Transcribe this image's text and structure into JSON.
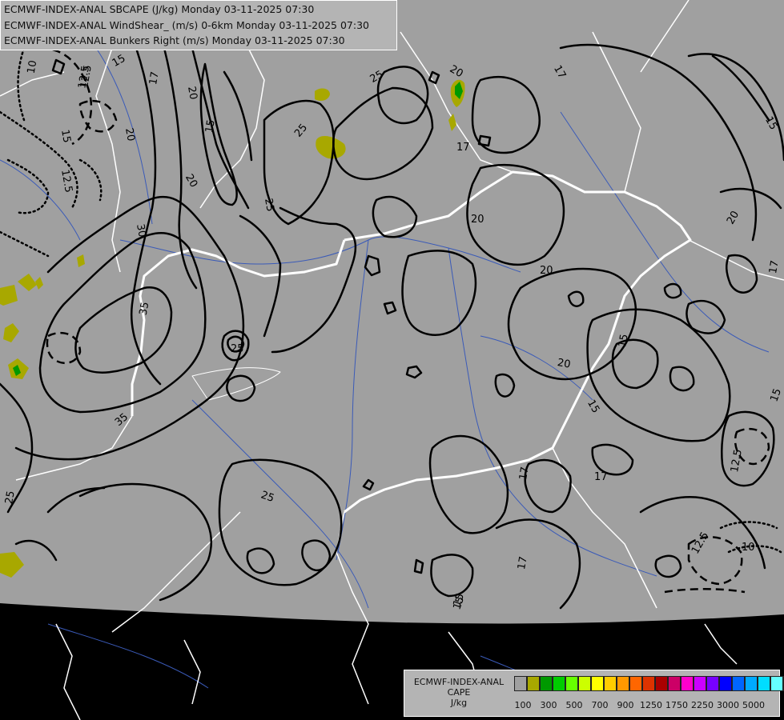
{
  "header": {
    "lines": [
      "ECMWF-INDEX-ANAL SBCAPE (J/kg) Monday 03-11-2025 07:30",
      "ECMWF-INDEX-ANAL WindShear_ (m/s) 0-6km Monday 03-11-2025 07:30",
      "ECMWF-INDEX-ANAL Bunkers Right (m/s) Monday 03-11-2025 07:30"
    ]
  },
  "legend": {
    "title_lines": [
      "ECMWF-INDEX-ANAL",
      "CAPE",
      "J/kg"
    ],
    "colors": [
      "#a0a0a0",
      "#a8a800",
      "#009900",
      "#00cc00",
      "#66ff00",
      "#ccff00",
      "#ffff00",
      "#ffcc00",
      "#ff9900",
      "#ff6600",
      "#dd3300",
      "#aa0000",
      "#cc0066",
      "#ff00cc",
      "#cc00ff",
      "#7700ff",
      "#0000ff",
      "#0066ff",
      "#00aaff",
      "#00ddff",
      "#66ffff",
      "#ffffff"
    ],
    "tick_labels": [
      "100",
      "300",
      "500",
      "700",
      "900",
      "1250",
      "1750",
      "2250",
      "3000",
      "5000"
    ]
  },
  "contour_labels": [
    "10",
    "12.5",
    "15",
    "17",
    "20",
    "25",
    "30",
    "35",
    "12.5",
    "12.5",
    "15",
    "17",
    "20",
    "25",
    "25",
    "20",
    "20",
    "15",
    "17",
    "15",
    "12.5",
    "12.5",
    "10",
    "20",
    "17",
    "15",
    "17",
    "15",
    "25",
    "35",
    "25",
    "17",
    "20",
    "20",
    "20",
    "15",
    "17",
    "15",
    "25",
    "15"
  ],
  "colors": {
    "map_gray": "#a0a0a0",
    "background": "#000000",
    "border": "#ffffff",
    "river": "#3a5ab8",
    "contour": "#000000",
    "cape_low": "#a8a800",
    "cape_green": "#009900"
  }
}
